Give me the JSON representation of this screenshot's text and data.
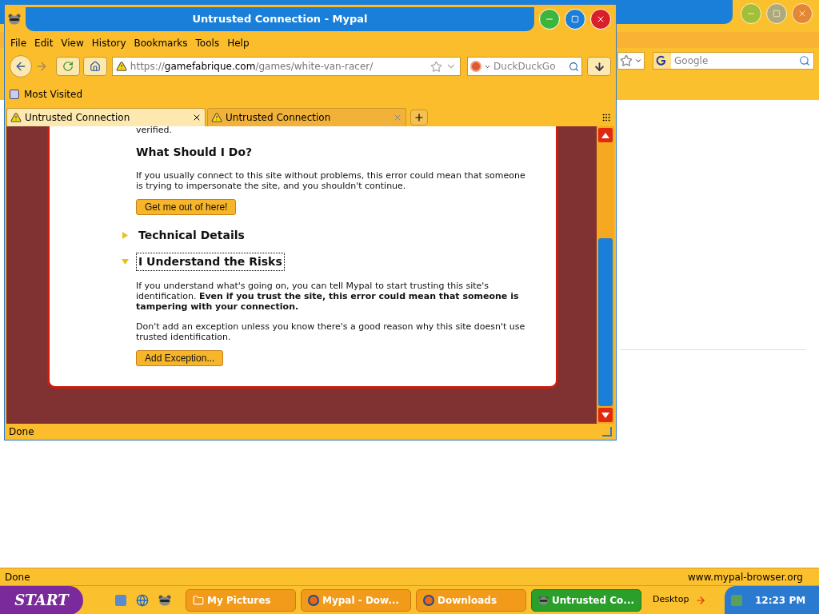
{
  "background_window": {
    "search_placeholder": "Google",
    "status": "Done",
    "status_url": "www.mypal-browser.org"
  },
  "window": {
    "title": "Untrusted Connection - Mypal",
    "menu": [
      "File",
      "Edit",
      "View",
      "History",
      "Bookmarks",
      "Tools",
      "Help"
    ],
    "url": {
      "scheme": "https://",
      "host": "gamefabrique.com",
      "path": "/games/white-van-racer/"
    },
    "search_placeholder": "DuckDuckGo",
    "bookmarks": [
      "Most Visited"
    ],
    "tabs": [
      {
        "label": "Untrusted Connection",
        "selected": true
      },
      {
        "label": "Untrusted Connection",
        "selected": false
      }
    ],
    "page": {
      "cut_text": "verified.",
      "heading": "What Should I Do?",
      "intro": "If you usually connect to this site without problems, this error could mean that someone is trying to impersonate the site, and you shouldn't continue.",
      "escape_button": "Get me out of here!",
      "sections": [
        {
          "title": "Technical Details",
          "expanded": false
        },
        {
          "title": "I Understand the Risks",
          "expanded": true
        }
      ],
      "risk_text": "If you understand what's going on, you can tell Mypal to start trusting this site's identification. **Even if you trust the site, this error could mean that someone is tampering with your connection.**",
      "exception_text": "Don't add an exception unless you know there's a good reason why this site doesn't use trusted identification.",
      "exception_button": "Add Exception..."
    },
    "status": "Done"
  },
  "taskbar": {
    "start": "START",
    "buttons": [
      {
        "label": "My Pictures",
        "kind": "folder",
        "selected": false
      },
      {
        "label": "Mypal - Dow...",
        "kind": "browser",
        "selected": false
      },
      {
        "label": "Downloads",
        "kind": "browser",
        "selected": false
      },
      {
        "label": "Untrusted Co...",
        "kind": "raccoon",
        "selected": true
      }
    ],
    "desktop": "Desktop",
    "clock": "12:23 PM"
  }
}
